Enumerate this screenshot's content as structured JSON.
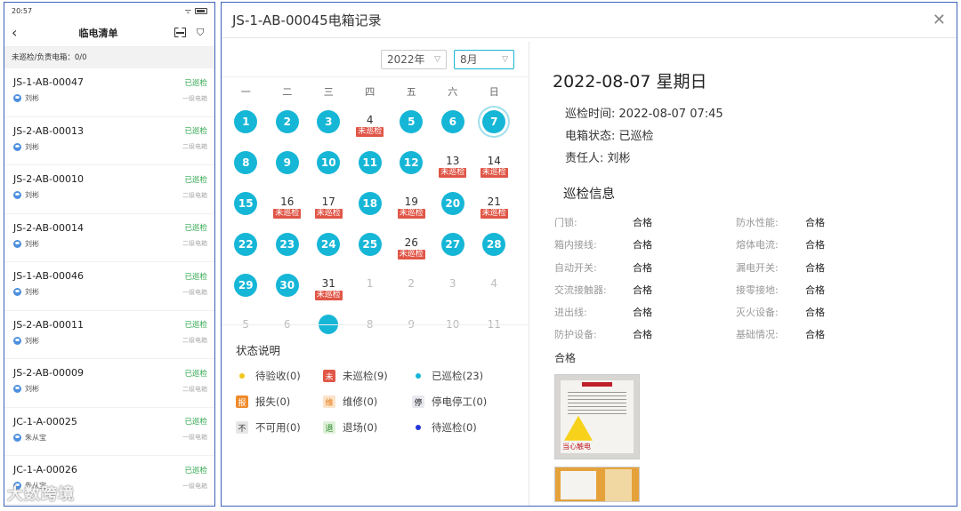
{
  "phone": {
    "status_time": "20:57",
    "title": "临电清单",
    "summary": "未巡检/负责电箱：0/0",
    "items": [
      {
        "code": "JS-1-AB-00047",
        "status": "已巡检",
        "person": "刘彬",
        "level": "一级电箱"
      },
      {
        "code": "JS-2-AB-00013",
        "status": "已巡检",
        "person": "刘彬",
        "level": "二级电箱"
      },
      {
        "code": "JS-2-AB-00010",
        "status": "已巡检",
        "person": "刘彬",
        "level": "二级电箱"
      },
      {
        "code": "JS-2-AB-00014",
        "status": "已巡检",
        "person": "刘彬",
        "level": "二级电箱"
      },
      {
        "code": "JS-1-AB-00046",
        "status": "已巡检",
        "person": "刘彬",
        "level": "一级电箱"
      },
      {
        "code": "JS-2-AB-00011",
        "status": "已巡检",
        "person": "刘彬",
        "level": "二级电箱"
      },
      {
        "code": "JS-2-AB-00009",
        "status": "已巡检",
        "person": "刘彬",
        "level": "二级电箱"
      },
      {
        "code": "JC-1-A-00025",
        "status": "已巡检",
        "person": "朱从宝",
        "level": "一级电箱"
      },
      {
        "code": "JC-1-A-00026",
        "status": "已巡检",
        "person": "朱从宝",
        "level": "一级电箱"
      }
    ]
  },
  "dialog": {
    "title": "JS-1-AB-00045电箱记录",
    "year_select": "2022年",
    "month_select": "8月",
    "weekdays": [
      "一",
      "二",
      "三",
      "四",
      "五",
      "六",
      "日"
    ],
    "unchecked_tag": "未巡检",
    "calendar": [
      [
        {
          "d": "1",
          "s": "done"
        },
        {
          "d": "2",
          "s": "done"
        },
        {
          "d": "3",
          "s": "done"
        },
        {
          "d": "4",
          "s": "miss"
        },
        {
          "d": "5",
          "s": "done"
        },
        {
          "d": "6",
          "s": "done"
        },
        {
          "d": "7",
          "s": "today"
        }
      ],
      [
        {
          "d": "8",
          "s": "done"
        },
        {
          "d": "9",
          "s": "done"
        },
        {
          "d": "10",
          "s": "done"
        },
        {
          "d": "11",
          "s": "done"
        },
        {
          "d": "12",
          "s": "done"
        },
        {
          "d": "13",
          "s": "miss"
        },
        {
          "d": "14",
          "s": "miss"
        }
      ],
      [
        {
          "d": "15",
          "s": "done"
        },
        {
          "d": "16",
          "s": "miss"
        },
        {
          "d": "17",
          "s": "miss"
        },
        {
          "d": "18",
          "s": "done"
        },
        {
          "d": "19",
          "s": "miss"
        },
        {
          "d": "20",
          "s": "done"
        },
        {
          "d": "21",
          "s": "miss"
        }
      ],
      [
        {
          "d": "22",
          "s": "done"
        },
        {
          "d": "23",
          "s": "done"
        },
        {
          "d": "24",
          "s": "done"
        },
        {
          "d": "25",
          "s": "done"
        },
        {
          "d": "26",
          "s": "miss"
        },
        {
          "d": "27",
          "s": "done"
        },
        {
          "d": "28",
          "s": "done"
        }
      ],
      [
        {
          "d": "29",
          "s": "done"
        },
        {
          "d": "30",
          "s": "done"
        },
        {
          "d": "31",
          "s": "miss"
        },
        {
          "d": "1",
          "s": "grey"
        },
        {
          "d": "2",
          "s": "grey"
        },
        {
          "d": "3",
          "s": "grey"
        },
        {
          "d": "4",
          "s": "grey"
        }
      ],
      [
        {
          "d": "5",
          "s": "grey"
        },
        {
          "d": "6",
          "s": "grey"
        },
        {
          "d": "7",
          "s": "gdot"
        },
        {
          "d": "8",
          "s": "grey"
        },
        {
          "d": "9",
          "s": "grey"
        },
        {
          "d": "10",
          "s": "grey"
        },
        {
          "d": "11",
          "s": "grey"
        }
      ]
    ],
    "legend_title": "状态说明",
    "legend": [
      {
        "mark": "dot-y",
        "glyph": "",
        "label": "待验收(0)"
      },
      {
        "mark": "sq-r",
        "glyph": "未",
        "label": "未巡检(9)"
      },
      {
        "mark": "dot-c",
        "glyph": "",
        "label": "已巡检(23)"
      },
      {
        "mark": "sq-o",
        "glyph": "报",
        "label": "报失(0)"
      },
      {
        "mark": "sq-o2",
        "glyph": "维",
        "label": "维修(0)"
      },
      {
        "mark": "sq-dk",
        "glyph": "停",
        "label": "停电停工(0)"
      },
      {
        "mark": "sq-g",
        "glyph": "不",
        "label": "不可用(0)"
      },
      {
        "mark": "sq-gr",
        "glyph": "退",
        "label": "退场(0)"
      },
      {
        "mark": "dot-b",
        "glyph": "",
        "label": "待巡检(0)"
      }
    ],
    "detail": {
      "date_title": "2022-08-07 星期日",
      "time_label": "巡检时间:",
      "time_value": "2022-08-07 07:45",
      "state_label": "电箱状态:",
      "state_value": "已巡检",
      "owner_label": "责任人:",
      "owner_value": "刘彬",
      "section_title": "巡检信息",
      "checks": [
        {
          "k": "门锁:",
          "v": "合格"
        },
        {
          "k": "防水性能:",
          "v": "合格"
        },
        {
          "k": "箱内接线:",
          "v": "合格"
        },
        {
          "k": "熔体电流:",
          "v": "合格"
        },
        {
          "k": "自动开关:",
          "v": "合格"
        },
        {
          "k": "漏电开关:",
          "v": "合格"
        },
        {
          "k": "交流接触器:",
          "v": "合格"
        },
        {
          "k": "接零接地:",
          "v": "合格"
        },
        {
          "k": "进出线:",
          "v": "合格"
        },
        {
          "k": "灭火设备:",
          "v": "合格"
        },
        {
          "k": "防护设备:",
          "v": "合格"
        },
        {
          "k": "基础情况:",
          "v": "合格"
        }
      ],
      "photo_label": "合格",
      "photo_sign": "当心触电"
    }
  },
  "watermark": "大数跨境"
}
